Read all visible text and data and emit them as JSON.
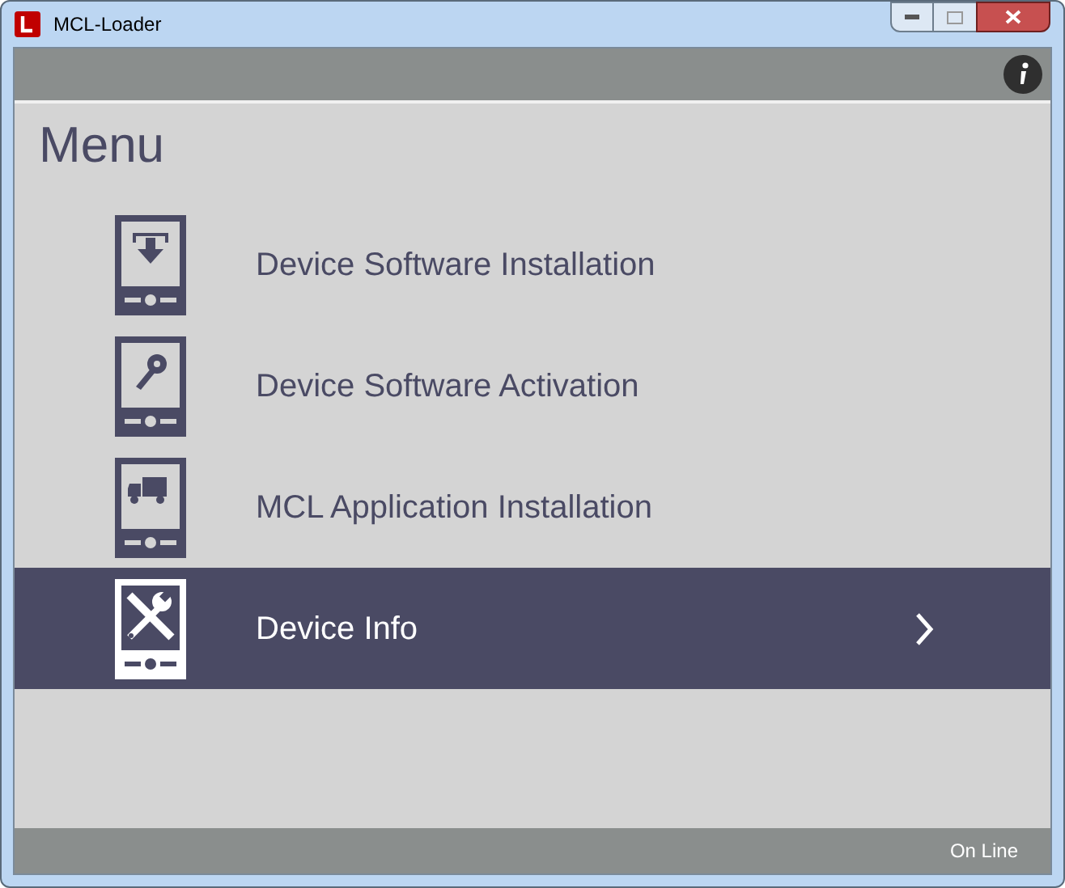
{
  "window": {
    "title": "MCL-Loader"
  },
  "heading": "Menu",
  "menu_items": [
    {
      "label": "Device Software Installation",
      "kind": "download",
      "selected": false
    },
    {
      "label": "Device Software Activation",
      "kind": "key",
      "selected": false
    },
    {
      "label": "MCL Application Installation",
      "kind": "truck",
      "selected": false
    },
    {
      "label": "Device Info",
      "kind": "tools",
      "selected": true
    }
  ],
  "status_bar": {
    "text": "On Line"
  }
}
